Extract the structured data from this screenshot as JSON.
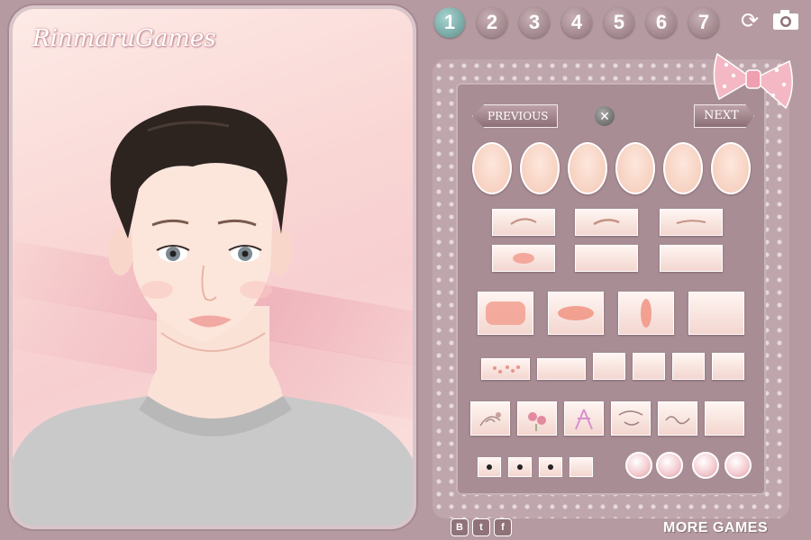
{
  "brand": {
    "logo_text": "RinmaruGames"
  },
  "steps": [
    {
      "label": "1",
      "active": true
    },
    {
      "label": "2",
      "active": false
    },
    {
      "label": "3",
      "active": false
    },
    {
      "label": "4",
      "active": false
    },
    {
      "label": "5",
      "active": false
    },
    {
      "label": "6",
      "active": false
    },
    {
      "label": "7",
      "active": false
    }
  ],
  "toolbar": {
    "reset_icon": "refresh-icon",
    "camera_icon": "camera-icon"
  },
  "panel": {
    "previous_label": "PREVIOUS",
    "next_label": "NEXT",
    "remove_icon": "close-icon",
    "accent_colors": {
      "frame": "#bfa6ad",
      "panel": "#a88d94",
      "option": "#f3d6cf",
      "active_step": "#5d8f8b"
    }
  },
  "footer": {
    "social": [
      "B",
      "t",
      "f"
    ],
    "more_games_label": "MORE GAMES"
  }
}
